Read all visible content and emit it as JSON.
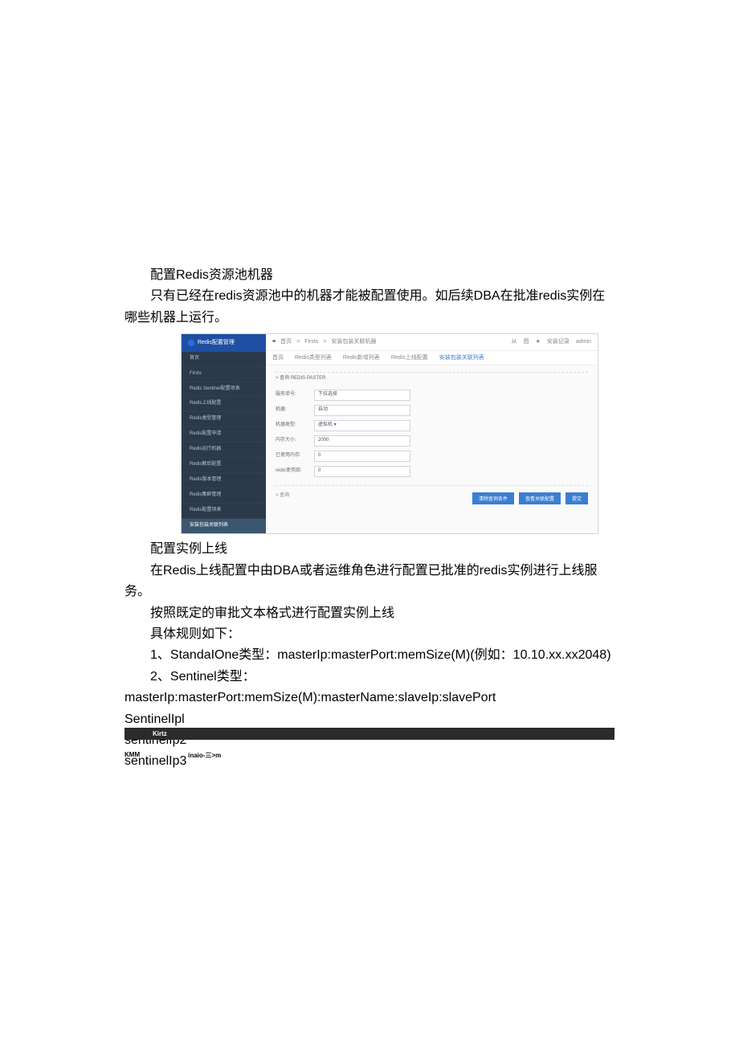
{
  "doc": {
    "h1": "配置Redis资源池机器",
    "p1": "只有已经在redis资源池中的机器才能被配置使用。如后续DBA在批准redis实例在哪些机器上运行。",
    "h2": "配置实例上线",
    "p2": "在Redis上线配置中由DBA或者运维角色进行配置已批准的redis实例进行上线服务。",
    "p3": "按照既定的审批文本格式进行配置实例上线",
    "p4": "具体规则如下：",
    "rule1": "1、StandaIOne类型：masterIp:masterPort:memSize(M)(例如：10.10.xx.xx2048)",
    "rule2": "2、Sentinel类型：",
    "rule2b": "masterIp:masterPort:memSize(M):masterName:slaveIp:slavePort",
    "s1": "SentinelIpl",
    "s2": "sentinelIp2",
    "s3": "sentinelIp3"
  },
  "screenshot": {
    "logo": "Redis配置管理",
    "breadcrumb": {
      "home": "首页",
      "sep": ">",
      "p1": "Firsts",
      "p2": "安装包装关联机器"
    },
    "topright": {
      "a": "从",
      "b": "图",
      "c": "★",
      "d": "安装记录",
      "user": "admin"
    },
    "tabs": {
      "t0": "首页",
      "t1": "Redis类型列表",
      "t2": "Redis新增列表",
      "t3": "Redis上线配置",
      "t4": "安装包装关联列表"
    },
    "sidebar": [
      "首页",
      "Firsts",
      "Redis Sentinel配置项表",
      "Redis上线配置",
      "Redis类型管理",
      "Redis配置申请",
      "Redis运行机器",
      "Redis解后配置",
      "Redis版本管理",
      "Redis集群管理",
      "Redis配置项表",
      "安装包装关联列表"
    ],
    "activeSidebarIndex": 11,
    "collapse1": "> 查询    REDIS PASTER",
    "form": {
      "f1": {
        "label": "服务单号:",
        "value": "下拉选择"
      },
      "f2": {
        "label": "机器:",
        "value": "自动"
      },
      "f3": {
        "label": "机器类型:",
        "value": "虚拟机  ▾"
      },
      "f4": {
        "label": "内存大小:",
        "value": "2000"
      },
      "f5": {
        "label": "已使用内存:",
        "value": "0"
      },
      "f6": {
        "label": "redis使用部:",
        "value": "0"
      }
    },
    "collapse2": "> 查询",
    "buttons": {
      "b1": "清除查询条件",
      "b2": "查看关联配置",
      "b3": "提交"
    }
  },
  "footer": {
    "title": "Kirtz",
    "kmm": "KMM",
    "raw": "inaio-三>m"
  }
}
